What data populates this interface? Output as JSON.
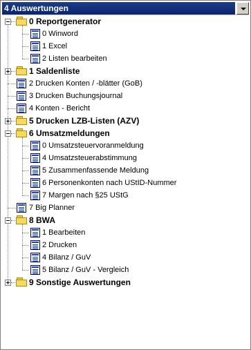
{
  "combo": {
    "selected": "4 Auswertungen"
  },
  "tree": [
    {
      "label": "0 Reportgenerator",
      "type": "folder",
      "expanded": true,
      "children": [
        {
          "label": "0 Winword"
        },
        {
          "label": "1 Excel"
        },
        {
          "label": "2 Listen bearbeiten"
        }
      ]
    },
    {
      "label": "1 Saldenliste",
      "type": "folder",
      "expanded": false
    },
    {
      "label": "2 Drucken Konten / -blätter (GoB)",
      "type": "doc"
    },
    {
      "label": "3 Drucken Buchungsjournal",
      "type": "doc"
    },
    {
      "label": "4 Konten - Bericht",
      "type": "doc"
    },
    {
      "label": "5 Drucken LZB-Listen (AZV)",
      "type": "folder",
      "expanded": false
    },
    {
      "label": "6 Umsatzmeldungen",
      "type": "folder",
      "expanded": true,
      "children": [
        {
          "label": "0 Umsatzsteuervoranmeldung"
        },
        {
          "label": "4 Umsatzsteuerabstimmung"
        },
        {
          "label": "5 Zusammenfassende Meldung"
        },
        {
          "label": "6 Personenkonten nach UStID-Nummer"
        },
        {
          "label": "7 Margen nach §25 UStG"
        }
      ]
    },
    {
      "label": "7 Big Planner",
      "type": "doc"
    },
    {
      "label": "8 BWA",
      "type": "folder",
      "expanded": true,
      "children": [
        {
          "label": "1 Bearbeiten"
        },
        {
          "label": "2 Drucken"
        },
        {
          "label": "4 Bilanz / GuV"
        },
        {
          "label": "5 Bilanz / GuV - Vergleich"
        }
      ]
    },
    {
      "label": "9 Sonstige Auswertungen",
      "type": "folder",
      "expanded": false
    }
  ]
}
